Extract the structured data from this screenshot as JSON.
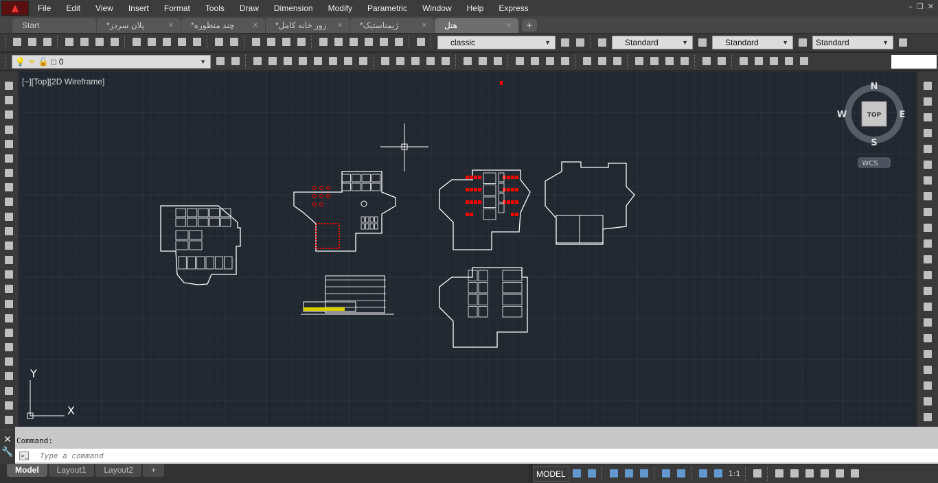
{
  "menu": [
    "File",
    "Edit",
    "View",
    "Insert",
    "Format",
    "Tools",
    "Draw",
    "Dimension",
    "Modify",
    "Parametric",
    "Window",
    "Help",
    "Express"
  ],
  "tabs": [
    {
      "label": "Start"
    },
    {
      "label": "*پلان سردز"
    },
    {
      "label": "*چند منظوره"
    },
    {
      "label": "*زور خانه کامل"
    },
    {
      "label": "*ژیمناستیک"
    },
    {
      "label": "هتل",
      "active": true
    }
  ],
  "toolbar1": {
    "workspace": "classic",
    "text_style": "Standard",
    "dim_style": "Standard",
    "table_style": "Standard"
  },
  "toolbar2": {
    "layer": "0"
  },
  "viewport": {
    "label": "[−][Top][2D Wireframe]",
    "viewcube": {
      "top": "TOP",
      "n": "N",
      "s": "S",
      "e": "E",
      "w": "W",
      "ucs": "WCS"
    },
    "ucs_x": "X",
    "ucs_y": "Y"
  },
  "command": {
    "history": "Command:",
    "placeholder": "Type a command"
  },
  "layout_tabs": [
    "Model",
    "Layout1",
    "Layout2",
    "+"
  ],
  "status": {
    "model": "MODEL",
    "scale": "1:1"
  },
  "colors": {
    "viewport_bg": "#212830",
    "drawing": "#ffffff",
    "highlight": "#ff0000",
    "accent": "#3d8ee8"
  }
}
